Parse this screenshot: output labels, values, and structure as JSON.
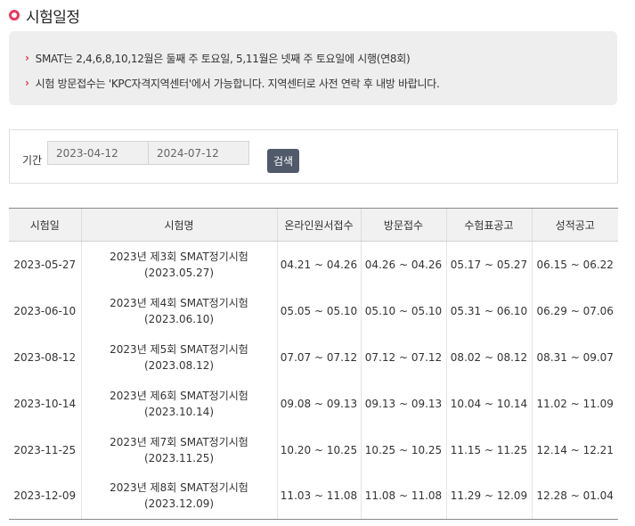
{
  "page": {
    "title": "시험일정"
  },
  "notice": {
    "items": [
      "SMAT는 2,4,6,8,10,12월은 둘째 주 토요일, 5,11월은 넷째 주 토요일에 시행(연8회)",
      "시험 방문접수는 'KPC자격지역센터'에서 가능합니다. 지역센터로 사전 연락 후 내방 바랍니다."
    ]
  },
  "search": {
    "period_label": "기간",
    "date_from": "2023-04-12",
    "date_to": "2024-07-12",
    "button_label": "검색"
  },
  "table": {
    "headers": [
      "시험일",
      "시험명",
      "온라인원서접수",
      "방문접수",
      "수험표공고",
      "성적공고"
    ],
    "rows": [
      {
        "date": "2023-05-27",
        "name_line1": "2023년 제3회 SMAT정기시험",
        "name_line2": "(2023.05.27)",
        "online": "04.21 ~ 04.26",
        "visit": "04.26 ~ 04.26",
        "ticket": "05.17 ~ 05.27",
        "result": "06.15 ~ 06.22"
      },
      {
        "date": "2023-06-10",
        "name_line1": "2023년 제4회 SMAT정기시험",
        "name_line2": "(2023.06.10)",
        "online": "05.05 ~ 05.10",
        "visit": "05.10 ~ 05.10",
        "ticket": "05.31 ~ 06.10",
        "result": "06.29 ~ 07.06"
      },
      {
        "date": "2023-08-12",
        "name_line1": "2023년 제5회 SMAT정기시험",
        "name_line2": "(2023.08.12)",
        "online": "07.07 ~ 07.12",
        "visit": "07.12 ~ 07.12",
        "ticket": "08.02 ~ 08.12",
        "result": "08.31 ~ 09.07"
      },
      {
        "date": "2023-10-14",
        "name_line1": "2023년 제6회 SMAT정기시험",
        "name_line2": "(2023.10.14)",
        "online": "09.08 ~ 09.13",
        "visit": "09.13 ~ 09.13",
        "ticket": "10.04 ~ 10.14",
        "result": "11.02 ~ 11.09"
      },
      {
        "date": "2023-11-25",
        "name_line1": "2023년 제7회 SMAT정기시험",
        "name_line2": "(2023.11.25)",
        "online": "10.20 ~ 10.25",
        "visit": "10.25 ~ 10.25",
        "ticket": "11.15 ~ 11.25",
        "result": "12.14 ~ 12.21"
      },
      {
        "date": "2023-12-09",
        "name_line1": "2023년 제8회 SMAT정기시험",
        "name_line2": "(2023.12.09)",
        "online": "11.03 ~ 11.08",
        "visit": "11.08 ~ 11.08",
        "ticket": "11.29 ~ 12.09",
        "result": "12.28 ~ 01.04"
      }
    ]
  },
  "colors": {
    "accent": "#e8395d",
    "chevron": "#d83a4a",
    "button": "#505a6a",
    "notice_bg": "#eeeeee",
    "header_bg": "#f1f1f1"
  }
}
